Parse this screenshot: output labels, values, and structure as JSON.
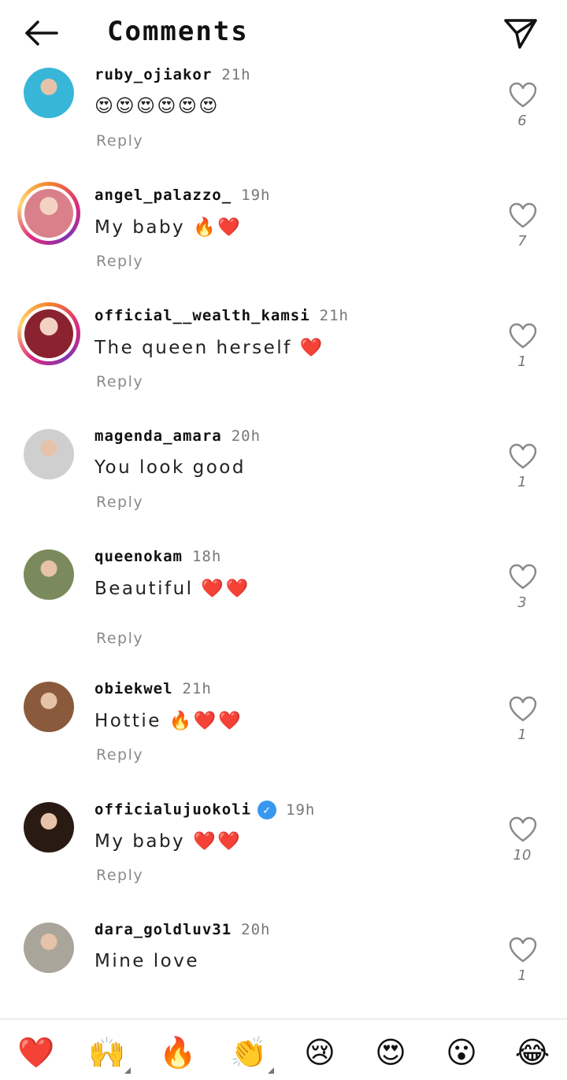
{
  "header": {
    "title": "Comments",
    "back_icon": "arrow-left-icon",
    "send_icon": "paper-plane-icon"
  },
  "comments": [
    {
      "username": "ruby_ojiakor",
      "time": "21h",
      "text": "😍😍😍😍😍😍",
      "reply": "Reply",
      "likes": "6",
      "verified": false,
      "story_ring": false,
      "avatar_color": "#38b6d8"
    },
    {
      "username": "angel_palazzo_",
      "time": "19h",
      "text": "My baby 🔥❤️",
      "reply": "Reply",
      "likes": "7",
      "verified": false,
      "story_ring": true,
      "avatar_color": "#d9808a"
    },
    {
      "username": "official__wealth_kamsi",
      "time": "21h",
      "text": "The queen herself ❤️",
      "reply": "Reply",
      "likes": "1",
      "verified": false,
      "story_ring": true,
      "avatar_color": "#8a2230"
    },
    {
      "username": "magenda_amara",
      "time": "20h",
      "text": "You look good",
      "reply": "Reply",
      "likes": "1",
      "verified": false,
      "story_ring": false,
      "avatar_color": "#cfcfcf"
    },
    {
      "username": "queenokam",
      "time": "18h",
      "text": "Beautiful ❤️❤️",
      "reply": "Reply",
      "likes": "3",
      "verified": false,
      "story_ring": false,
      "avatar_color": "#7a8a5c"
    },
    {
      "username": "obiekwel",
      "time": "21h",
      "text": "Hottie 🔥❤️❤️",
      "reply": "Reply",
      "likes": "1",
      "verified": false,
      "story_ring": false,
      "avatar_color": "#8a5a3c"
    },
    {
      "username": "officialujuokoli",
      "time": "19h",
      "text": "My baby ❤️❤️",
      "reply": "Reply",
      "likes": "10",
      "verified": true,
      "story_ring": false,
      "avatar_color": "#2a1a14"
    },
    {
      "username": "dara_goldluv31",
      "time": "20h",
      "text": "Mine love",
      "reply": "",
      "likes": "1",
      "verified": false,
      "story_ring": false,
      "avatar_color": "#a9a59a"
    }
  ],
  "reactions": [
    {
      "emoji": "❤️",
      "name": "heart"
    },
    {
      "emoji": "🙌",
      "name": "raised-hands"
    },
    {
      "emoji": "🔥",
      "name": "fire"
    },
    {
      "emoji": "👏",
      "name": "clapping-hands"
    },
    {
      "emoji": "😢",
      "name": "crying-face"
    },
    {
      "emoji": "😍",
      "name": "heart-eyes"
    },
    {
      "emoji": "😮",
      "name": "surprised-face"
    },
    {
      "emoji": "😂",
      "name": "tears-of-joy"
    }
  ],
  "colors": {
    "verified": "#3897f0",
    "muted": "#777777",
    "ring_start": "#f58529",
    "ring_end": "#dd2a7b"
  }
}
